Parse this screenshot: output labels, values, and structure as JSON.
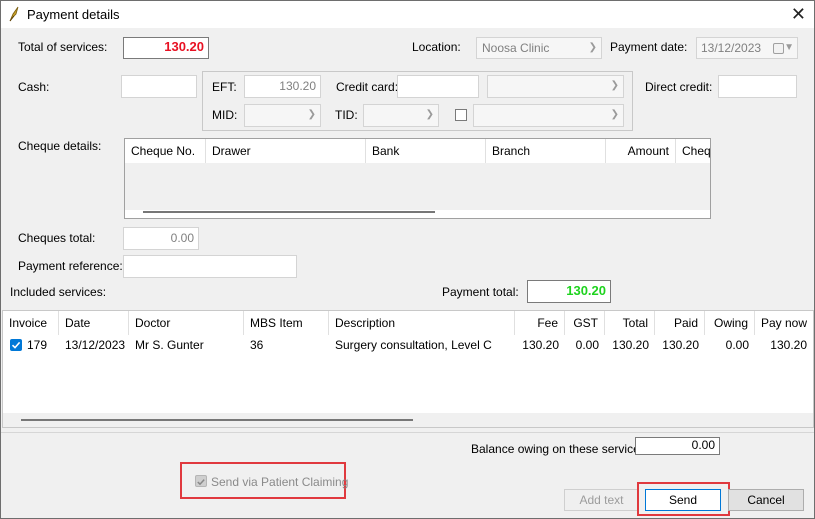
{
  "window": {
    "title": "Payment details",
    "icon": "app-feather-icon",
    "close_icon": "close-icon",
    "close_glyph": "✕"
  },
  "labels": {
    "total_services": "Total of services:",
    "location": "Location:",
    "payment_date": "Payment date:",
    "cash": "Cash:",
    "eft": "EFT:",
    "credit_card": "Credit card:",
    "direct_credit": "Direct credit:",
    "mid": "MID:",
    "tid": "TID:",
    "cheque_details": "Cheque details:",
    "cheques_total": "Cheques total:",
    "payment_reference": "Payment reference:",
    "included_services": "Included services:",
    "payment_total": "Payment total:",
    "balance_owing": "Balance owing on these services:"
  },
  "fields": {
    "total_services": "130.20",
    "location": "Noosa Clinic",
    "payment_date": "13/12/2023",
    "cash": "",
    "eft": "130.20",
    "credit_card": "",
    "credit_card_type": "",
    "direct_credit": "",
    "mid": "",
    "tid": "",
    "tid_extra": "",
    "cheques_total": "0.00",
    "payment_reference": "",
    "payment_total": "130.20",
    "balance_owing": "0.00"
  },
  "colors": {
    "total_red": "#e81123",
    "payment_green": "#1ed31e",
    "highlight": "#e0393e",
    "accent": "#0078d7"
  },
  "cheque_table": {
    "columns": [
      "Cheque No.",
      "Drawer",
      "Bank",
      "Branch",
      "Amount",
      "Cheque"
    ]
  },
  "services_table": {
    "columns": [
      "Invoice",
      "Date",
      "Doctor",
      "MBS Item",
      "Description",
      "Fee",
      "GST",
      "Total",
      "Paid",
      "Owing",
      "Pay now"
    ],
    "rows": [
      {
        "checked": true,
        "invoice": "179",
        "date": "13/12/2023",
        "doctor": "Mr S. Gunter",
        "mbs_item": "36",
        "description": "Surgery consultation, Level C",
        "fee": "130.20",
        "gst": "0.00",
        "total": "130.20",
        "paid": "130.20",
        "owing": "0.00",
        "pay_now": "130.20"
      }
    ]
  },
  "send_via_claiming": {
    "label": "Send via Patient Claiming",
    "checked": true
  },
  "buttons": {
    "add_text": "Add text",
    "send": "Send",
    "cancel": "Cancel"
  }
}
